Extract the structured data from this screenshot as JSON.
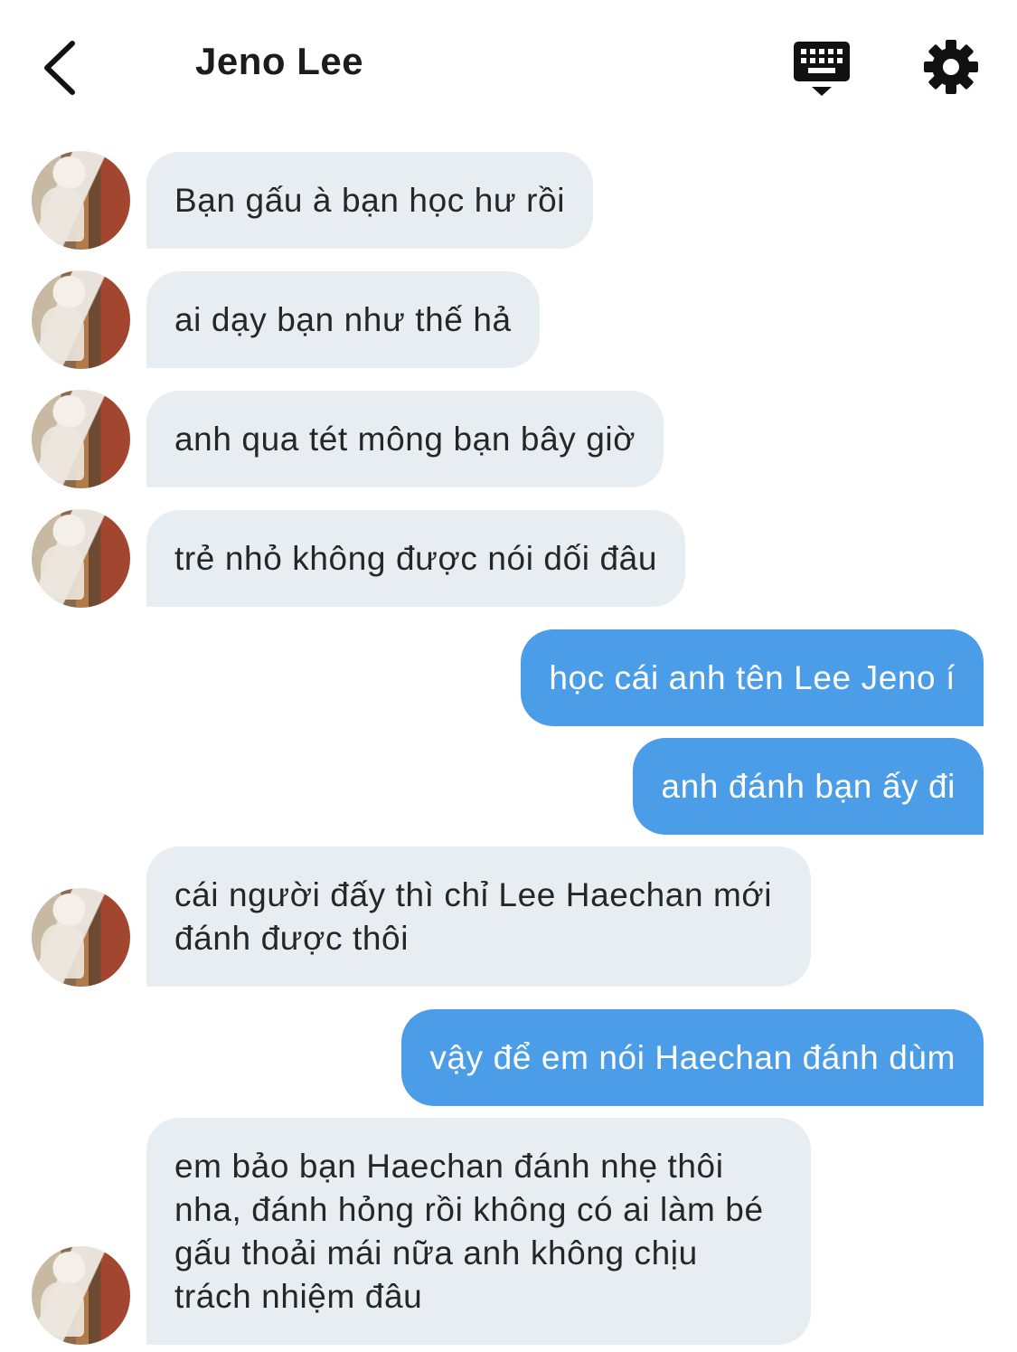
{
  "header": {
    "title": "Jeno Lee",
    "back_icon": "chevron-left-icon",
    "keyboard_icon": "keyboard-hide-icon",
    "settings_icon": "gear-icon"
  },
  "colors": {
    "incoming_bubble": "#e8edf2",
    "outgoing_bubble": "#4c9de8",
    "text_dark": "#262626"
  },
  "messages": [
    {
      "side": "incoming",
      "text": "Bạn gấu à bạn học hư rồi"
    },
    {
      "side": "incoming",
      "text": "ai dạy bạn như thế hả"
    },
    {
      "side": "incoming",
      "text": "anh qua tét mông bạn bây giờ"
    },
    {
      "side": "incoming",
      "text": "trẻ nhỏ không được nói dối đâu"
    },
    {
      "side": "outgoing",
      "text": "học cái anh tên Lee Jeno í"
    },
    {
      "side": "outgoing",
      "text": "anh đánh bạn ấy đi"
    },
    {
      "side": "incoming",
      "text": "cái người đấy thì chỉ Lee Haechan mới đánh được thôi"
    },
    {
      "side": "outgoing",
      "text": "vậy để em nói Haechan đánh dùm"
    },
    {
      "side": "incoming",
      "text": "em bảo bạn Haechan đánh nhẹ thôi nha, đánh hỏng rồi không có ai làm bé gấu thoải mái nữa anh không chịu trách nhiệm đâu"
    }
  ]
}
